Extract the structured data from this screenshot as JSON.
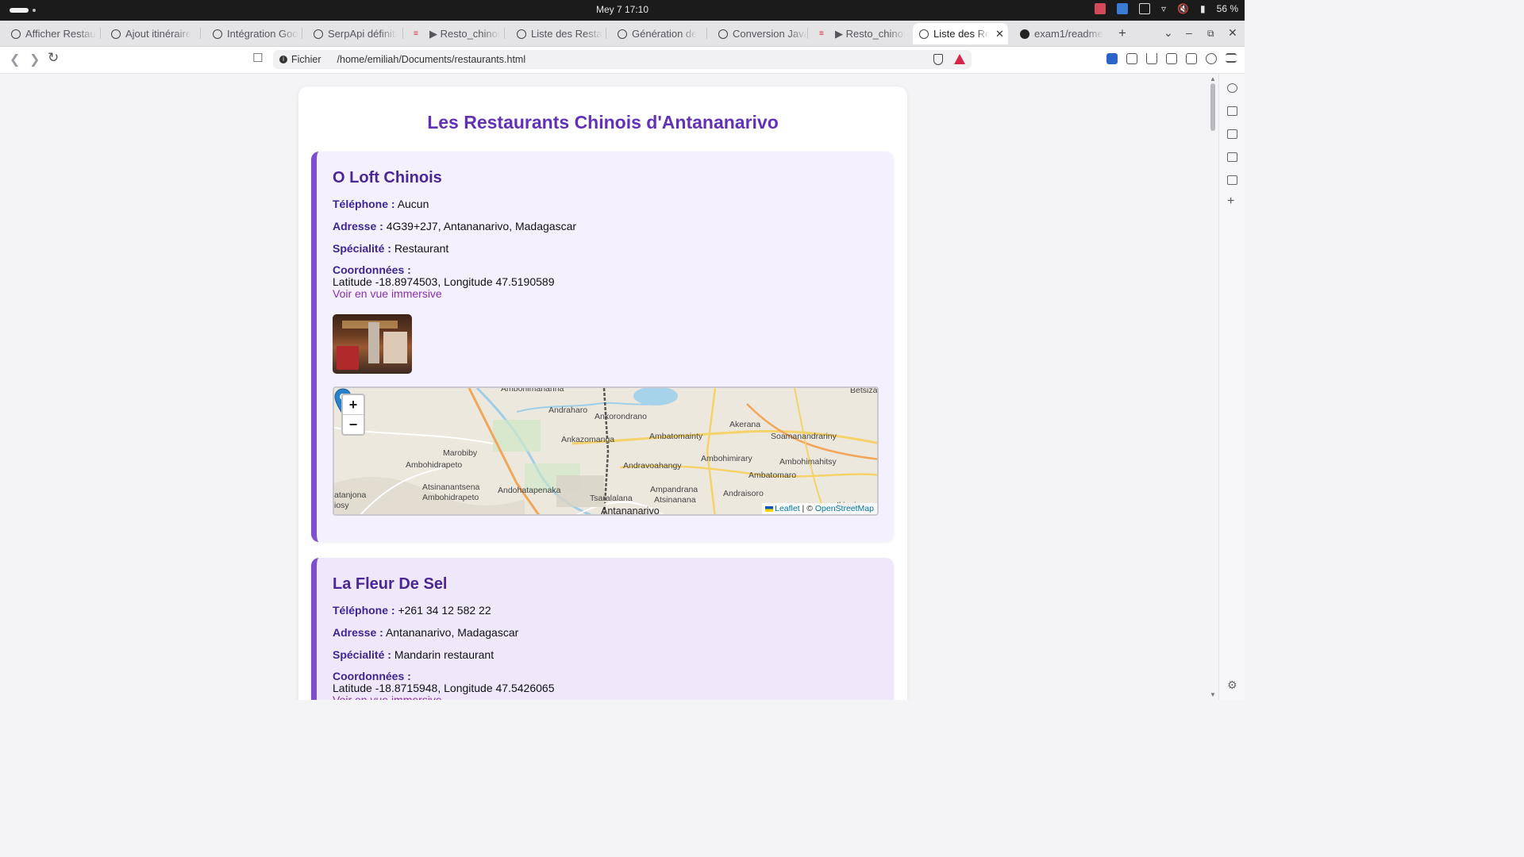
{
  "os": {
    "clock": "Mey 7  17:10",
    "battery": "56 %"
  },
  "browser": {
    "tabs": [
      {
        "title": "Afficher Restau",
        "icon": "chatgpt-icon"
      },
      {
        "title": "Ajout itinéraire",
        "icon": "chatgpt-icon"
      },
      {
        "title": "Intégration Goo",
        "icon": "chatgpt-icon"
      },
      {
        "title": "SerpApi définiti",
        "icon": "chatgpt-icon"
      },
      {
        "title": "▶ Resto_chinoi",
        "icon": "youtube-icon"
      },
      {
        "title": "Liste des Resta",
        "icon": "globe-icon"
      },
      {
        "title": "Génération de",
        "icon": "chatgpt-icon"
      },
      {
        "title": "Conversion Java",
        "icon": "chatgpt-icon"
      },
      {
        "title": "▶ Resto_chinoi",
        "icon": "youtube-icon"
      },
      {
        "title": "Liste des Re",
        "icon": "globe-icon",
        "active": true
      },
      {
        "title": "exam1/readme",
        "icon": "github-icon"
      }
    ],
    "url_scheme": "Fichier",
    "url": "/home/emiliah/Documents/restaurants.html"
  },
  "page": {
    "title": "Les Restaurants Chinois d'Antananarivo",
    "labels": {
      "phone": "Téléphone :",
      "address": "Adresse :",
      "specialty": "Spécialité :",
      "coords": "Coordonnées :",
      "immersive": "Voir en vue immersive"
    },
    "restaurants": [
      {
        "name": "O Loft Chinois",
        "phone": "Aucun",
        "address": "4G39+2J7, Antananarivo, Madagascar",
        "specialty": "Restaurant",
        "coords": "Latitude -18.8974503, Longitude 47.5190589"
      },
      {
        "name": "La Fleur De Sel",
        "phone": "+261 34 12 582 22",
        "address": "Antananarivo, Madagascar",
        "specialty": "Mandarin restaurant",
        "coords": "Latitude -18.8715948, Longitude 47.5426065"
      }
    ],
    "map": {
      "zoom_in": "+",
      "zoom_out": "−",
      "attribution_leaflet": "Leaflet",
      "attribution_sep": " | © ",
      "attribution_osm": "OpenStreetMap",
      "places": [
        "Ambohimanarina",
        "Betsizaraina",
        "Andraharo",
        "Ankorondrano",
        "Akerana",
        "Soamanandrariny",
        "Ambatomainty",
        "Ankazomanga",
        "Marobiby",
        "Ambohidrapeto",
        "Ambohimirary",
        "Ambohimahitsy",
        "Andravoahangy",
        "Ambatomaro",
        "Atsinanantsena",
        "Ambohidrapeto",
        "Andohatapenaka",
        "Ampandrana",
        "Andraisoro",
        "Tsaralalana",
        "Atsinanana",
        "Ikianja",
        "atanjona",
        "iosy",
        "Antananarivo"
      ]
    }
  }
}
